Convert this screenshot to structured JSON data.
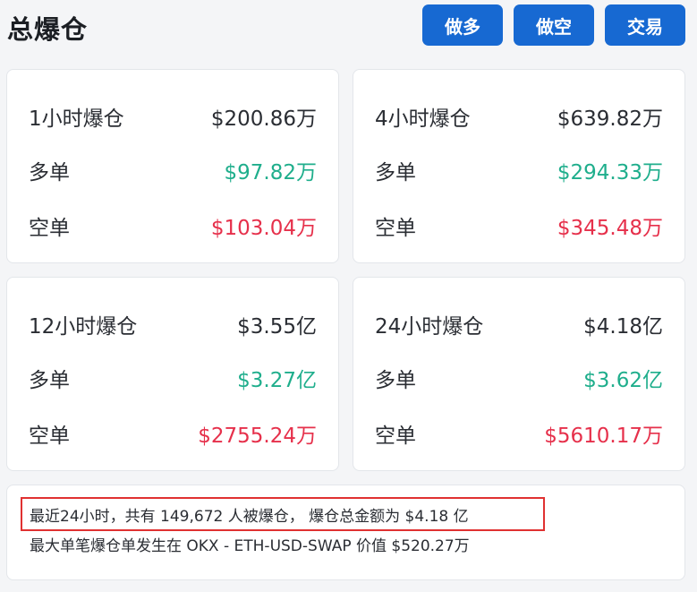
{
  "header": {
    "title": "总爆仓",
    "buttons": {
      "long": "做多",
      "short": "做空",
      "trade": "交易"
    }
  },
  "colors": {
    "primary": "#1769d2",
    "long": "#1fae8c",
    "short": "#e6304b",
    "highlight_border": "#e03131"
  },
  "cards": [
    {
      "period": "1小时爆仓",
      "total": "$200.86万",
      "long_label": "多单",
      "long_value": "$97.82万",
      "short_label": "空单",
      "short_value": "$103.04万"
    },
    {
      "period": "4小时爆仓",
      "total": "$639.82万",
      "long_label": "多单",
      "long_value": "$294.33万",
      "short_label": "空单",
      "short_value": "$345.48万"
    },
    {
      "period": "12小时爆仓",
      "total": "$3.55亿",
      "long_label": "多单",
      "long_value": "$3.27亿",
      "short_label": "空单",
      "short_value": "$2755.24万"
    },
    {
      "period": "24小时爆仓",
      "total": "$4.18亿",
      "long_label": "多单",
      "long_value": "$3.62亿",
      "short_label": "空单",
      "short_value": "$5610.17万"
    }
  ],
  "summary": {
    "line1": "最近24小时，共有 149,672 人被爆仓， 爆仓总金额为 $4.18 亿",
    "line2": "最大单笔爆仓单发生在 OKX - ETH-USD-SWAP 价值 $520.27万"
  }
}
